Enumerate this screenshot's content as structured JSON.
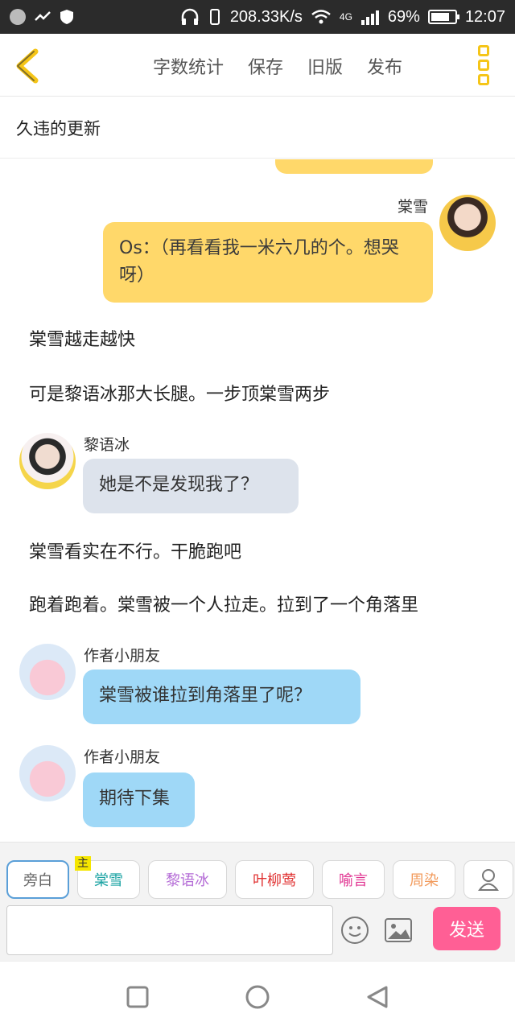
{
  "status": {
    "speed": "208.33K/s",
    "network": "4G",
    "battery": "69%",
    "time": "12:07"
  },
  "toolbar": {
    "actions": [
      "字数统计",
      "保存",
      "旧版",
      "发布"
    ]
  },
  "page": {
    "title": "久违的更新"
  },
  "messages": [
    {
      "type": "bubble_right",
      "sender": "棠雪",
      "text": "Os：（再看看我一米六几的个。想哭呀）",
      "color": "#ffd86a"
    },
    {
      "type": "narration",
      "text": "棠雪越走越快"
    },
    {
      "type": "narration",
      "text": "可是黎语冰那大长腿。一步顶棠雪两步"
    },
    {
      "type": "bubble_left",
      "sender": "黎语冰",
      "text": "她是不是发现我了？",
      "color": "#dde3ec"
    },
    {
      "type": "narration",
      "text": "棠雪看实在不行。干脆跑吧"
    },
    {
      "type": "narration",
      "text": "跑着跑着。棠雪被一个人拉走。拉到了一个角落里"
    },
    {
      "type": "bubble_left",
      "sender": "作者小朋友",
      "text": "棠雪被谁拉到角落里了呢？",
      "color": "#9fd8f7"
    },
    {
      "type": "bubble_left",
      "sender": "作者小朋友",
      "text": "期待下集",
      "color": "#9fd8f7"
    }
  ],
  "composer": {
    "main_tag": "主",
    "roles": [
      {
        "label": "旁白",
        "color": "#666666"
      },
      {
        "label": "棠雪",
        "color": "#1aa3a3"
      },
      {
        "label": "黎语冰",
        "color": "#b46bd6"
      },
      {
        "label": "叶柳莺",
        "color": "#e03030"
      },
      {
        "label": "喻言",
        "color": "#e0308f"
      },
      {
        "label": "周染",
        "color": "#f29a5b"
      }
    ],
    "input_value": "",
    "send_label": "发送"
  },
  "icons": [
    "back-icon",
    "more-icon",
    "emoji-icon",
    "image-icon",
    "add-role-icon",
    "recent-apps-icon",
    "home-icon",
    "nav-back-icon"
  ]
}
